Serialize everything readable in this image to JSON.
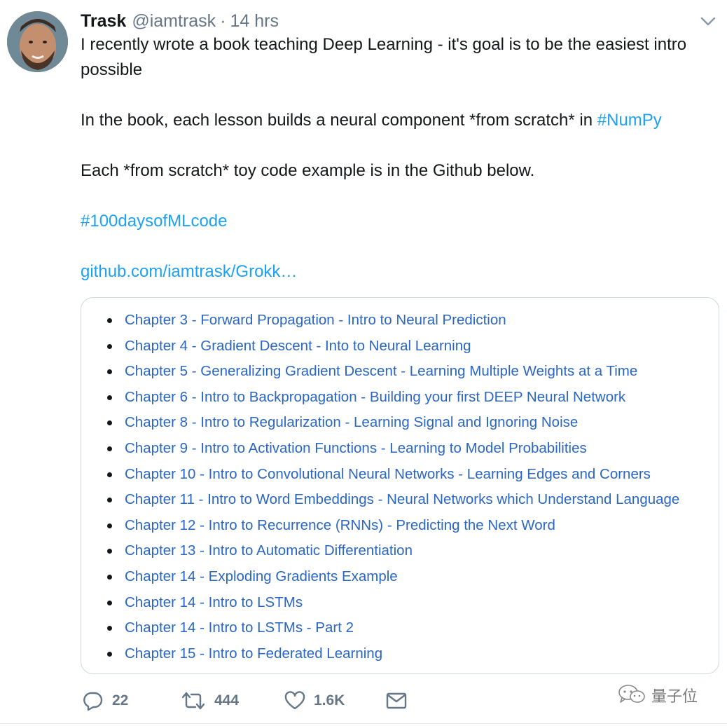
{
  "tweet": {
    "author_name": "Trask",
    "handle": "@iamtrask",
    "separator": "·",
    "time": "14 hrs",
    "line1": "I recently wrote a book teaching Deep Learning - it's goal is to be the easiest intro possible",
    "line2_text": "In the book, each lesson builds a neural component *from scratch* in ",
    "line2_hashtag": "#NumPy",
    "line3": "Each *from scratch* toy code example is in the Github below.",
    "hashtag": "#100daysofMLcode",
    "url": "github.com/iamtrask/Grokk…"
  },
  "card": {
    "chapters": [
      "Chapter 3 - Forward Propagation - Intro to Neural Prediction",
      "Chapter 4 - Gradient Descent - Into to Neural Learning",
      "Chapter 5 - Generalizing Gradient Descent - Learning Multiple Weights at a Time",
      "Chapter 6 - Intro to Backpropagation - Building your first DEEP Neural Network",
      "Chapter 8 - Intro to Regularization - Learning Signal and Ignoring Noise",
      "Chapter 9 - Intro to Activation Functions - Learning to Model Probabilities",
      "Chapter 10 - Intro to Convolutional Neural Networks - Learning Edges and Corners",
      "Chapter 11 - Intro to Word Embeddings - Neural Networks which Understand Language",
      "Chapter 12 - Intro to Recurrence (RNNs) - Predicting the Next Word",
      "Chapter 13 - Intro to Automatic Differentiation",
      "Chapter 14 - Exploding Gradients Example",
      "Chapter 14 - Intro to LSTMs",
      "Chapter 14 - Intro to LSTMs - Part 2",
      "Chapter 15 - Intro to Federated Learning"
    ]
  },
  "actions": {
    "reply_count": "22",
    "retweet_count": "444",
    "like_count": "1.6K"
  },
  "watermark": {
    "text": "量子位"
  },
  "icons": {
    "caret": "chevron-down-icon",
    "reply": "reply-icon",
    "retweet": "retweet-icon",
    "like": "heart-icon",
    "dm": "envelope-icon",
    "watermark": "wechat-icon"
  },
  "colors": {
    "link": "#1da1f2",
    "card_link": "#2a66c4",
    "muted": "#657786",
    "text": "#14171a"
  }
}
